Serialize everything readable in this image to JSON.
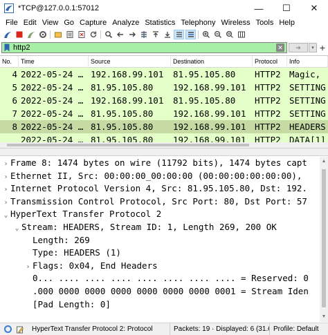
{
  "window": {
    "title": "*TCP@127.0.0.1:57012",
    "minimize_glyph": "—",
    "maximize_glyph": "☐",
    "close_glyph": "✕"
  },
  "menu": [
    "File",
    "Edit",
    "View",
    "Go",
    "Capture",
    "Analyze",
    "Statistics",
    "Telephony",
    "Wireless",
    "Tools",
    "Help"
  ],
  "toolbar": {
    "icons": [
      "shark-fin-start-icon",
      "stop-icon",
      "restart-icon",
      "options-gear-icon",
      "open-file-icon",
      "save-file-icon",
      "close-file-icon",
      "reload-icon",
      "find-icon",
      "back-icon",
      "forward-icon",
      "go-to-packet-icon",
      "first-packet-icon",
      "last-packet-icon",
      "autoscroll-icon",
      "colorize-icon",
      "zoom-in-icon",
      "zoom-out-icon",
      "normal-size-icon",
      "resize-columns-icon"
    ]
  },
  "filter": {
    "value": "http2",
    "clear_glyph": "✕",
    "apply_glyph": "➔",
    "dropdown_glyph": "▾",
    "add_glyph": "+"
  },
  "packet_list": {
    "headers": [
      "No.",
      "Time",
      "Source",
      "Destination",
      "Protocol",
      "Info"
    ],
    "rows": [
      {
        "no": "4",
        "time": "2022-05-24 …",
        "src": "192.168.99.101",
        "dst": "81.95.105.80",
        "proto": "HTTP2",
        "info": "Magic,",
        "bg": "#e4ffc7"
      },
      {
        "no": "5",
        "time": "2022-05-24 …",
        "src": "81.95.105.80",
        "dst": "192.168.99.101",
        "proto": "HTTP2",
        "info": "SETTING",
        "bg": "#e4ffc7"
      },
      {
        "no": "6",
        "time": "2022-05-24 …",
        "src": "192.168.99.101",
        "dst": "81.95.105.80",
        "proto": "HTTP2",
        "info": "SETTING",
        "bg": "#e4ffc7"
      },
      {
        "no": "7",
        "time": "2022-05-24 …",
        "src": "81.95.105.80",
        "dst": "192.168.99.101",
        "proto": "HTTP2",
        "info": "SETTING",
        "bg": "#e4ffc7"
      },
      {
        "no": "8",
        "time": "2022-05-24 …",
        "src": "81.95.105.80",
        "dst": "192.168.99.101",
        "proto": "HTTP2",
        "info": "HEADERS",
        "bg": "#c5dba3"
      },
      {
        "no": "",
        "time": "2022-05-24 …",
        "src": "81.95.105.80",
        "dst": "192.168.99.101",
        "proto": "HTTP2",
        "info": "DATA[1]",
        "bg": "#e4ffc7"
      }
    ]
  },
  "details": {
    "rows": [
      {
        "arrow": "›",
        "text": "Frame 8: 1474 bytes on wire (11792 bits), 1474 bytes capt",
        "indent": 0
      },
      {
        "arrow": "›",
        "text": "Ethernet II, Src: 00:00:00_00:00:00 (00:00:00:00:00:00),",
        "indent": 0
      },
      {
        "arrow": "›",
        "text": "Internet Protocol Version 4, Src: 81.95.105.80, Dst: 192.",
        "indent": 0
      },
      {
        "arrow": "›",
        "text": "Transmission Control Protocol, Src Port: 80, Dst Port: 57",
        "indent": 0
      },
      {
        "arrow": "⌄",
        "text": "HyperText Transfer Protocol 2",
        "indent": 0
      },
      {
        "arrow": "⌄",
        "text": "Stream: HEADERS, Stream ID: 1, Length 269, 200 OK",
        "indent": 1
      },
      {
        "arrow": "",
        "text": "Length: 269",
        "indent": 2
      },
      {
        "arrow": "",
        "text": "Type: HEADERS (1)",
        "indent": 2
      },
      {
        "arrow": "›",
        "text": "Flags: 0x04, End Headers",
        "indent": 2
      },
      {
        "arrow": "",
        "text": "0... .... .... .... .... .... .... .... = Reserved: 0",
        "indent": 2
      },
      {
        "arrow": "",
        "text": ".000 0000 0000 0000 0000 0000 0000 0001 = Stream Iden",
        "indent": 2
      },
      {
        "arrow": "",
        "text": "[Pad Length: 0]",
        "indent": 2
      }
    ]
  },
  "status": {
    "description": "HyperText Transfer Protocol 2: Protocol",
    "packets": "Packets: 19 · Displayed: 6 (31.6%)",
    "profile": "Profile: Default"
  }
}
